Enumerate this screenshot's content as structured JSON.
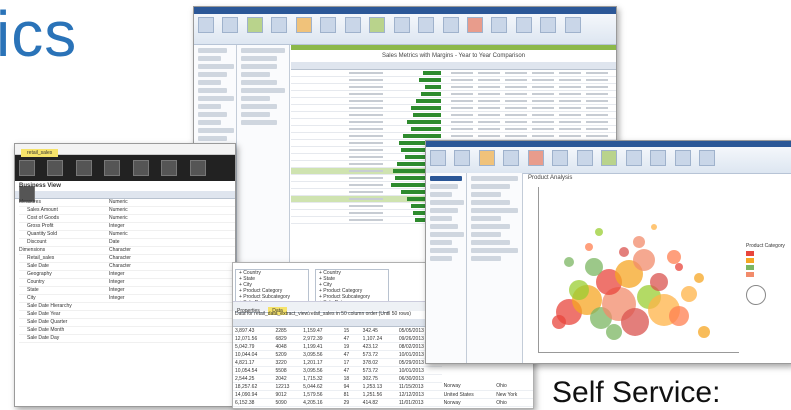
{
  "heading": "ics",
  "caption": "Self Service:",
  "screens": {
    "back_right": {
      "title": "Sales Metrics with Margins - Year to Year Comparison"
    },
    "left": {
      "tab_label": "retail_sales",
      "pane_title": "Business View",
      "side_labels": [
        "Measures",
        "Sales Amount",
        "Cost of Goods",
        "Gross Profit",
        "Quantity Sold",
        "Discount",
        "Dimensions",
        "Retail_sales",
        "Sale Date",
        "Geography",
        "Country",
        "State",
        "City",
        "Sale Date Hierarchy",
        "Sale Date Year",
        "Sale Date Quarter",
        "Sale Date Month",
        "Sale Date Day"
      ],
      "types": [
        "Numeric",
        "Numeric",
        "Numeric",
        "Integer",
        "Numeric",
        "Date",
        "Character",
        "Character",
        "Character",
        "Integer",
        "Integer",
        "Integer",
        "Integer"
      ]
    },
    "middle": {
      "list_items_a": [
        "Country",
        "State",
        "City",
        "Product Category",
        "Product Subcategory",
        "Sale Date"
      ],
      "list_items_b": [
        "Country",
        "State",
        "City",
        "Product Category",
        "Product Subcategory",
        "Sale Date"
      ],
      "status_text": "Data for retail_data_extract_view.retail_sales in 50 column order (Until 50 rows)",
      "rows": [
        [
          "3,897.43",
          "2285",
          "1,159.47",
          "15",
          "342.45",
          "05/05/2013"
        ],
        [
          "12,071.56",
          "6829",
          "2,972.39",
          "47",
          "1,107.24",
          "09/26/2013"
        ],
        [
          "5,042.79",
          "4048",
          "1,199.41",
          "19",
          "423.12",
          "08/02/2013"
        ],
        [
          "10,044.04",
          "5209",
          "3,095.56",
          "47",
          "573.72",
          "10/01/2013"
        ],
        [
          "4,821.17",
          "3220",
          "1,201.17",
          "17",
          "378.02",
          "05/29/2013"
        ],
        [
          "10,054.54",
          "5508",
          "3,095.56",
          "47",
          "573.72",
          "10/01/2013"
        ],
        [
          "2,544.25",
          "2042",
          "1,715.32",
          "18",
          "302.75",
          "06/30/2013"
        ],
        [
          "18,257.62",
          "12213",
          "5,044.62",
          "94",
          "1,253.13",
          "11/15/2013"
        ],
        [
          "14,090.94",
          "9012",
          "1,579.56",
          "81",
          "1,251.56",
          "12/12/2013"
        ],
        [
          "6,152.38",
          "5090",
          "4,205.16",
          "29",
          "414.82",
          "11/01/2013"
        ],
        [
          "4,540.34",
          "3819",
          "1,395.54",
          "15",
          "228.39",
          "11/15/2013"
        ],
        [
          "23,375.61",
          "21615",
          "10,594.63",
          "107",
          "1,795.09",
          "12/31/2013"
        ]
      ],
      "extra_cols": [
        [
          "Norway",
          "Ohio"
        ],
        [
          "United States",
          "New York"
        ],
        [
          "Norway",
          "Ohio"
        ],
        [
          "United States",
          "South Ca"
        ],
        [
          "United States",
          "Ohio"
        ]
      ]
    },
    "right": {
      "chart_title": "Product Analysis",
      "legend_title": "Product Category"
    }
  },
  "colors": {
    "heading": "#2a73b8",
    "ribbon_blue": "#2b5797",
    "bar_green": "#2e8b2e",
    "accent_green": "#8cb84a"
  }
}
